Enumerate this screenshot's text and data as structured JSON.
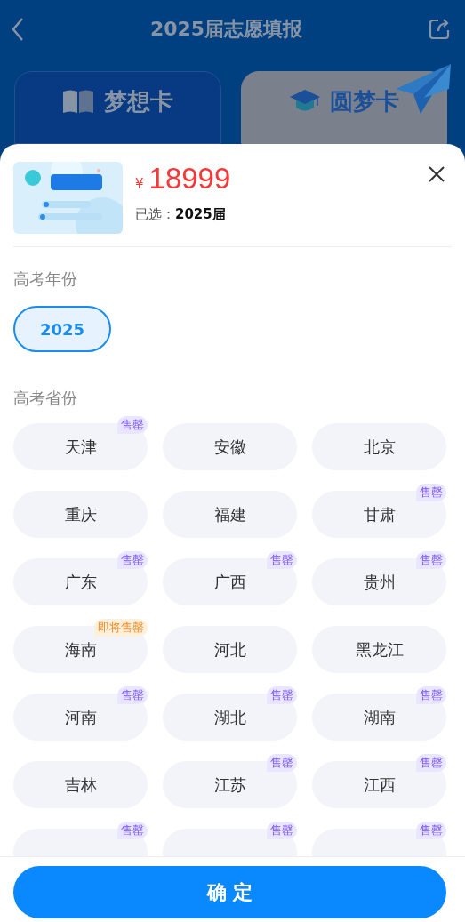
{
  "header": {
    "title": "2025届志愿填报"
  },
  "tabs": [
    {
      "label": "梦想卡",
      "kind": "book",
      "selected": false
    },
    {
      "label": "圆梦卡",
      "kind": "cap",
      "selected": true
    }
  ],
  "product": {
    "kind": "picture",
    "currency": "¥",
    "price": "18999",
    "selected_label": "已选：",
    "selected_value": "2025届"
  },
  "year_section": {
    "title": "高考年份",
    "options": [
      {
        "label": "2025",
        "selected": true
      }
    ]
  },
  "province_section": {
    "title": "高考省份",
    "options": [
      {
        "label": "天津",
        "badge": "售罄",
        "kind": "sold_out",
        "selected": false
      },
      {
        "label": "安徽",
        "selected": false
      },
      {
        "label": "北京",
        "selected": false
      },
      {
        "label": "重庆",
        "selected": false
      },
      {
        "label": "福建",
        "selected": false
      },
      {
        "label": "甘肃",
        "badge": "售罄",
        "kind": "sold_out",
        "selected": false
      },
      {
        "label": "广东",
        "badge": "售罄",
        "kind": "sold_out",
        "selected": false
      },
      {
        "label": "广西",
        "badge": "售罄",
        "kind": "sold_out",
        "selected": false
      },
      {
        "label": "贵州",
        "badge": "售罄",
        "kind": "sold_out",
        "selected": false
      },
      {
        "label": "海南",
        "badge": "即将售罄",
        "kind": "almost",
        "selected": false
      },
      {
        "label": "河北",
        "selected": false
      },
      {
        "label": "黑龙江",
        "selected": false
      },
      {
        "label": "河南",
        "badge": "售罄",
        "kind": "sold_out",
        "selected": false
      },
      {
        "label": "湖北",
        "badge": "售罄",
        "kind": "sold_out",
        "selected": false
      },
      {
        "label": "湖南",
        "badge": "售罄",
        "kind": "sold_out",
        "selected": false
      },
      {
        "label": "吉林",
        "selected": false
      },
      {
        "label": "江苏",
        "badge": "售罄",
        "kind": "sold_out",
        "selected": false
      },
      {
        "label": "江西",
        "badge": "售罄",
        "kind": "sold_out",
        "selected": false
      },
      {
        "badge": "售罄",
        "kind": "sold_out",
        "selected": false
      },
      {
        "badge": "售罄",
        "kind": "sold_out",
        "selected": false
      },
      {
        "badge": "售罄",
        "kind": "sold_out",
        "selected": false
      }
    ]
  },
  "confirm_button": {
    "label": "确 定"
  }
}
